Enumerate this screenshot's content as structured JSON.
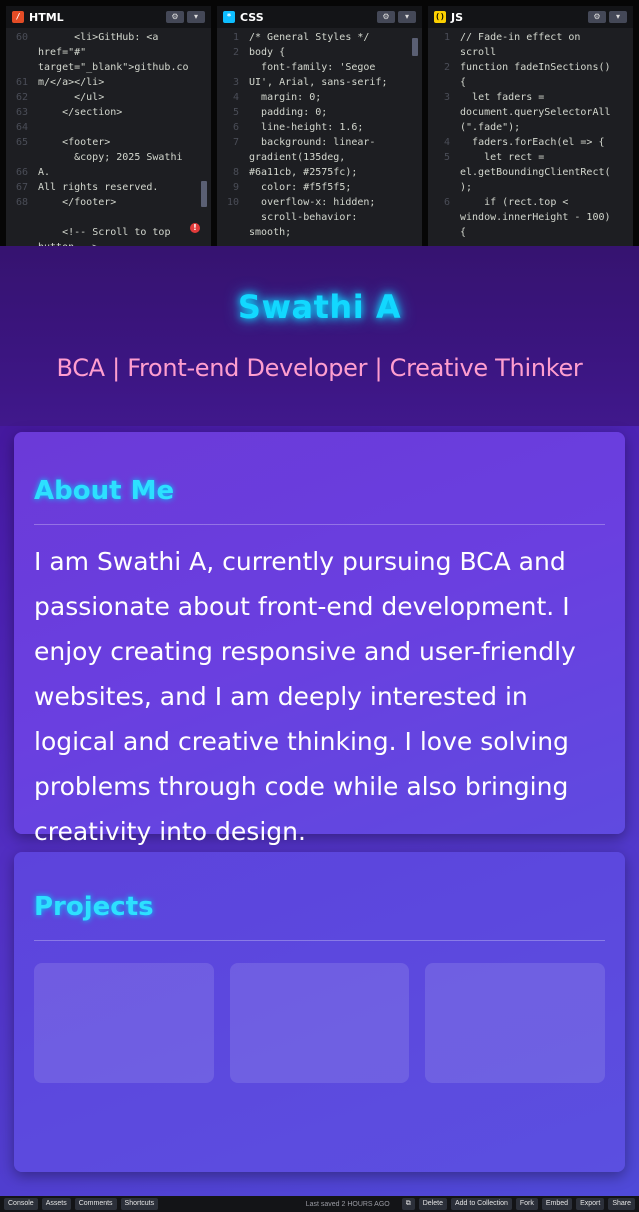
{
  "editors": {
    "html": {
      "title": "HTML",
      "gutter": [
        "60",
        "",
        "",
        "61",
        "62",
        "63",
        "64",
        "65",
        "",
        "66",
        "67",
        "68"
      ],
      "lines": [
        "      <li>GitHub: <a",
        "href=\"#\"",
        "target=\"_blank\">github.co",
        "m/</a></li>",
        "      </ul>",
        "    </section>",
        "",
        "    <footer>",
        "      &copy; 2025 Swathi A.",
        "All rights reserved.",
        "    </footer>",
        "",
        "    <!-- Scroll to top",
        "button -->"
      ],
      "error_badge": "!"
    },
    "css": {
      "title": "CSS",
      "gutter": [
        "1",
        "2",
        "",
        "3",
        "4",
        "5",
        "6",
        "7",
        "",
        "8",
        "9",
        "10",
        "",
        ""
      ],
      "lines": [
        "/* General Styles */",
        "body {",
        "  font-family: 'Segoe",
        "UI', Arial, sans-serif;",
        "  margin: 0;",
        "  padding: 0;",
        "  line-height: 1.6;",
        "  background: linear-",
        "gradient(135deg,",
        "#6a11cb, #2575fc);",
        "  color: #f5f5f5;",
        "  overflow-x: hidden;",
        "  scroll-behavior:",
        "smooth;"
      ]
    },
    "js": {
      "title": "JS",
      "gutter": [
        "1",
        "",
        "2",
        "",
        "3",
        "",
        "",
        "4",
        "5",
        "",
        "",
        "6",
        "",
        ""
      ],
      "lines": [
        "// Fade-in effect on",
        "scroll",
        "function fadeInSections()",
        "{",
        "  let faders =",
        "document.querySelectorAll",
        "(\".fade\");",
        "  faders.forEach(el => {",
        "    let rect =",
        "el.getBoundingClientRect(",
        ");",
        "    if (rect.top <",
        "window.innerHeight - 100)",
        "{"
      ]
    }
  },
  "preview": {
    "name": "Swathi A",
    "tagline": "BCA | Front-end Developer | Creative Thinker",
    "about": {
      "title": "About Me",
      "text": "I am Swathi A, currently pursuing BCA and passionate about front-end development. I enjoy creating responsive and user-friendly websites, and I am deeply interested in logical and creative thinking. I love solving problems through code while also bringing creativity into design."
    },
    "projects": {
      "title": "Projects"
    }
  },
  "bottombar": {
    "left": [
      "Console",
      "Assets",
      "Comments",
      "Shortcuts"
    ],
    "status": "Last saved 2 HOURS AGO",
    "right": [
      "Delete",
      "Add to Collection",
      "Fork",
      "Embed",
      "Export",
      "Share"
    ]
  },
  "colors": {
    "accent_cyan": "#12d8ff",
    "tagline_pink": "#ff9ecf",
    "gradient_start": "#6a11cb",
    "gradient_end": "#2575fc"
  }
}
